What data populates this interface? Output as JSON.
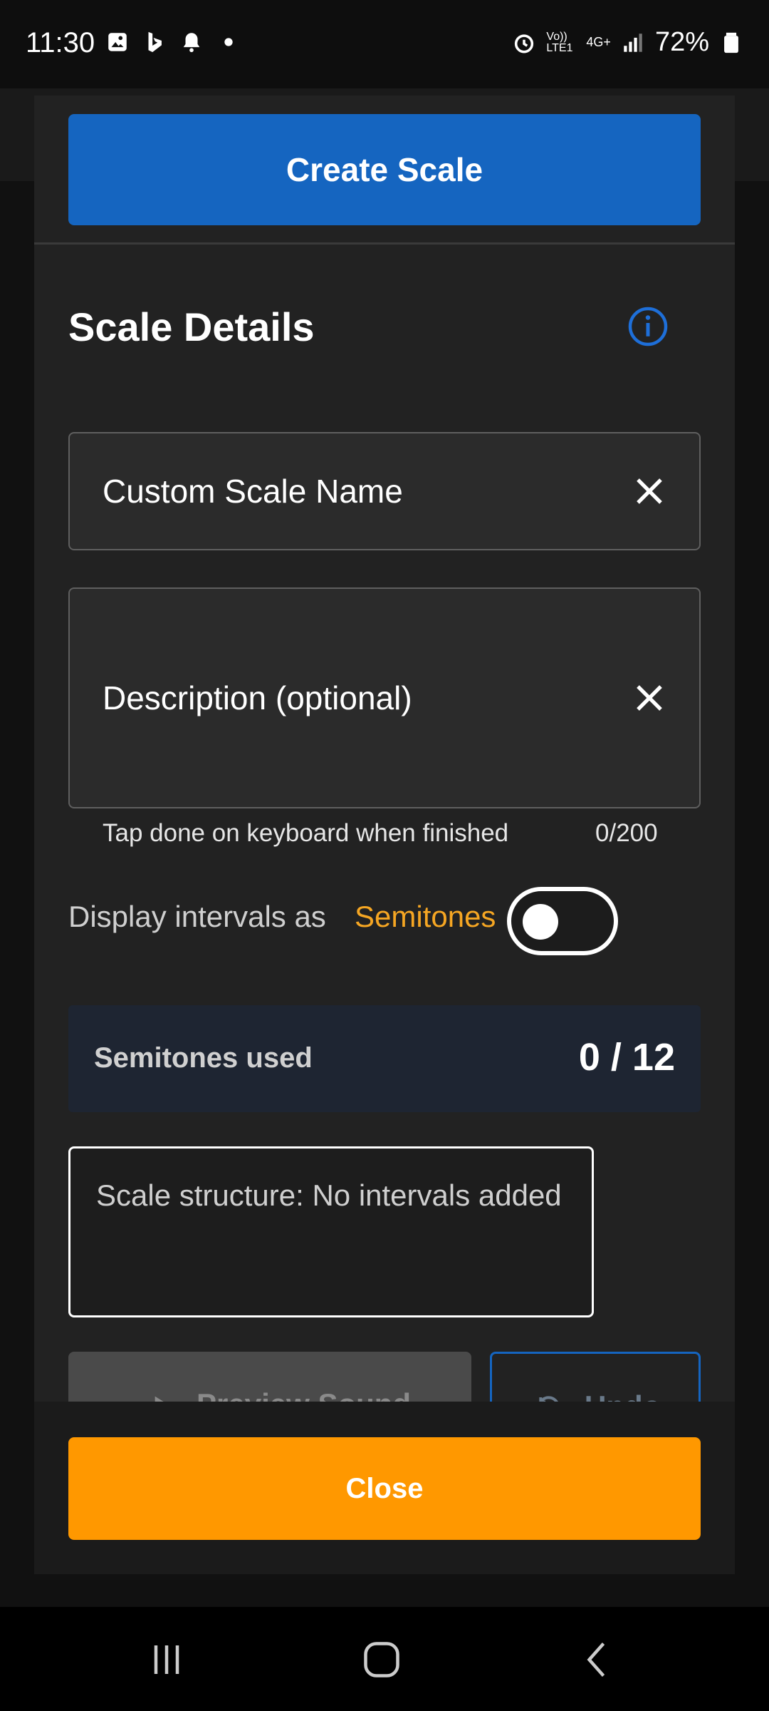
{
  "status_bar": {
    "time": "11:30",
    "battery": "72%",
    "network_label": "4G+",
    "volte_label": "Vo)) LTE1"
  },
  "dialog": {
    "create_button_label": "Create Scale",
    "section_title": "Scale Details",
    "name_field": {
      "placeholder": "Custom Scale Name",
      "value": ""
    },
    "description_field": {
      "placeholder": "Description (optional)",
      "value": ""
    },
    "helper_text": "Tap done on keyboard when finished",
    "char_counter": "0/200",
    "interval_toggle": {
      "label": "Display intervals as",
      "mode": "Semitones",
      "on": false
    },
    "semitones": {
      "label": "Semitones used",
      "value": "0 / 12"
    },
    "structure_text": "Scale structure: No intervals added",
    "preview_button_label": "Preview Sound",
    "undo_button_label": "Undo",
    "close_button_label": "Close"
  },
  "colors": {
    "primary_blue": "#1565c0",
    "accent_orange": "#ff9800",
    "mode_orange": "#f5a623"
  },
  "icons": [
    "gallery-icon",
    "bing-icon",
    "bell-icon",
    "alarm-icon",
    "signal-icon",
    "battery-icon",
    "info-icon",
    "close-icon",
    "recents-icon",
    "home-icon",
    "back-icon"
  ]
}
